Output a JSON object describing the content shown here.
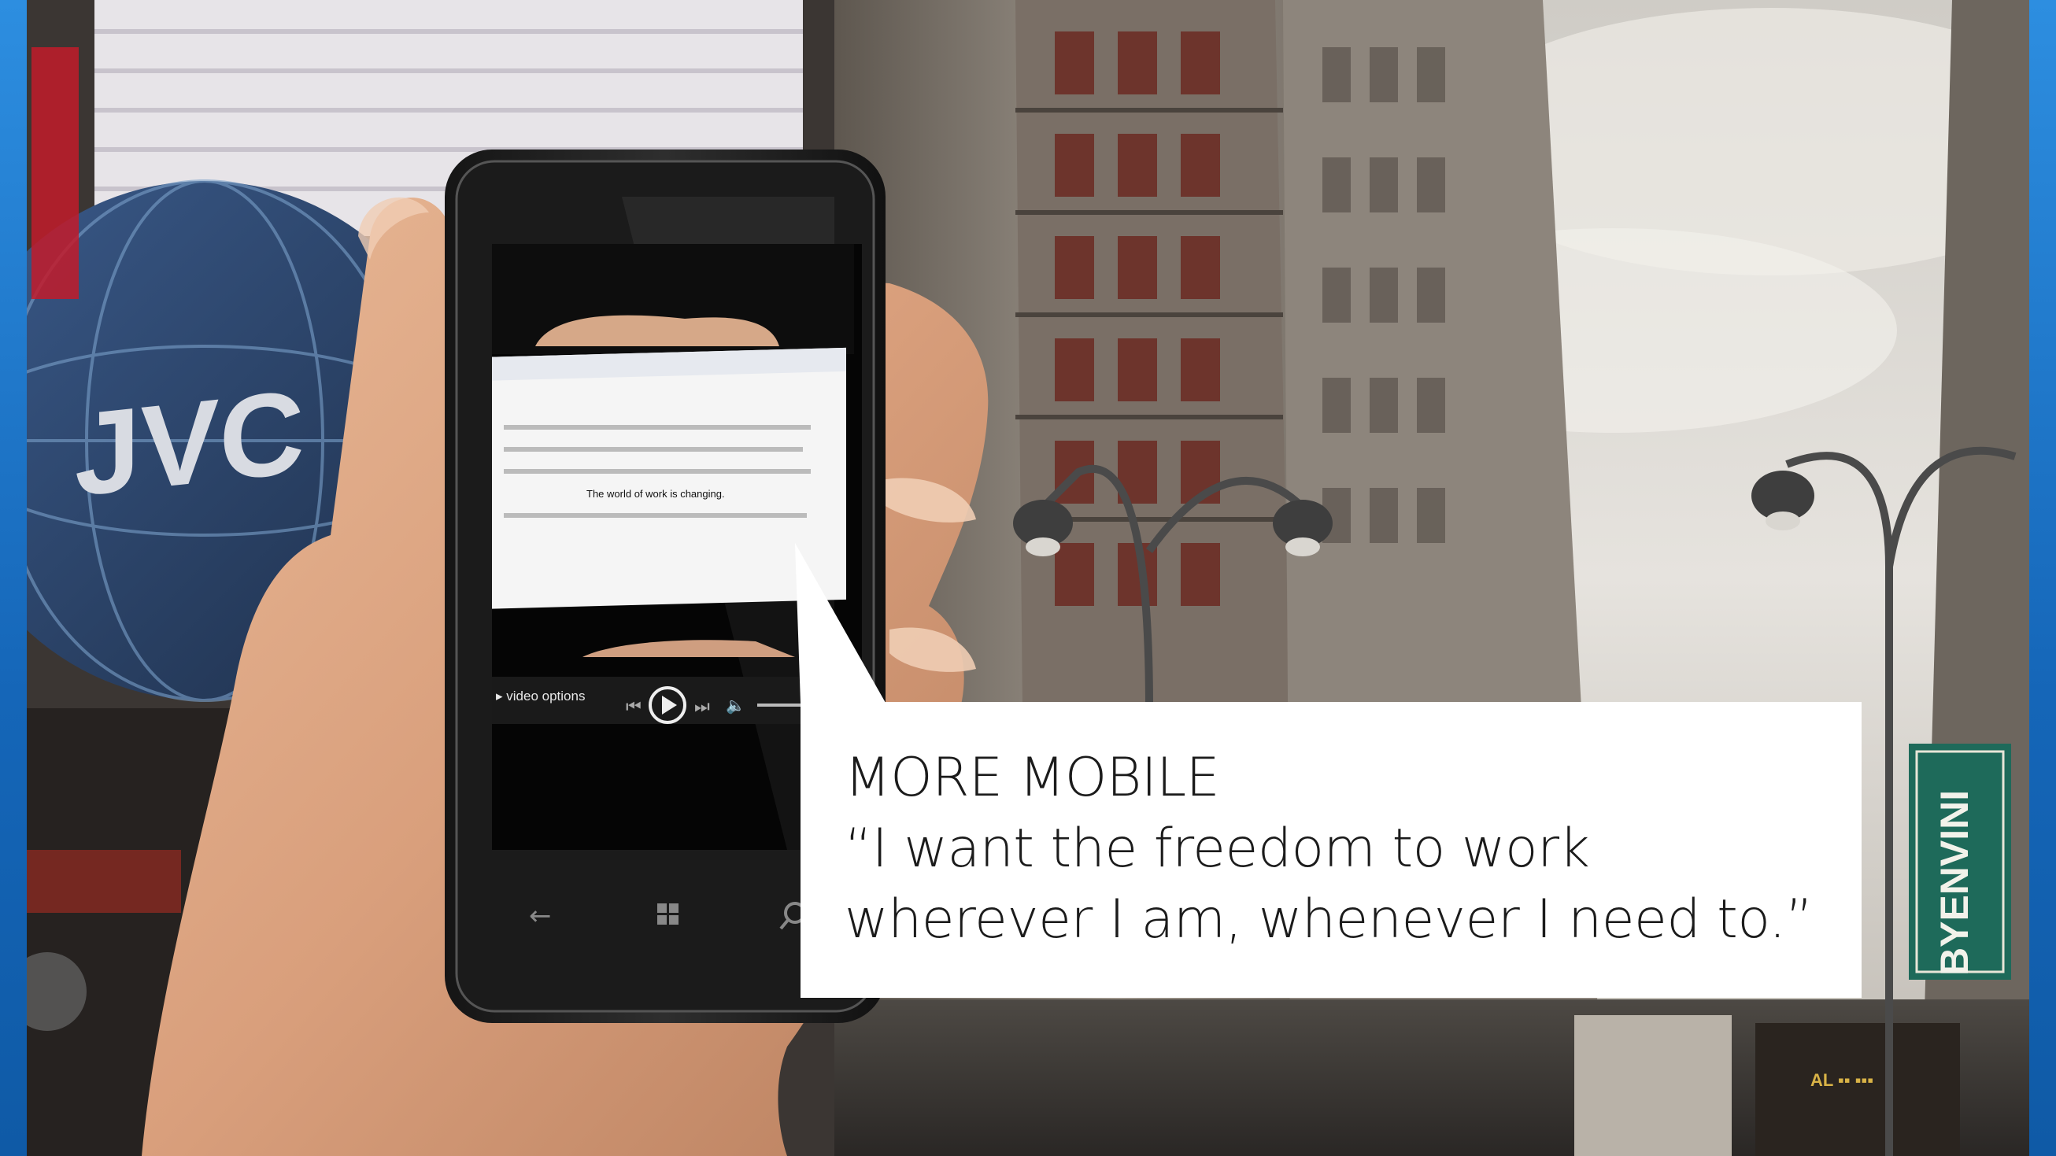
{
  "background": {
    "sky_color": "#d9d6d0",
    "building_color": "#8a8279",
    "edge_color": "#1f7fd6"
  },
  "billboard": {
    "brand": "JVC"
  },
  "street_sign": {
    "text": "BYENVINI"
  },
  "phone": {
    "document_highlight": "The world of work is changing.",
    "video_options_label": "▸ video options",
    "nav_icons": [
      "back-icon",
      "windows-icon",
      "search-icon"
    ]
  },
  "callout": {
    "title": "MORE MOBILE",
    "quote": "“I want the freedom to work wherever I am, whenever I need to.”"
  }
}
